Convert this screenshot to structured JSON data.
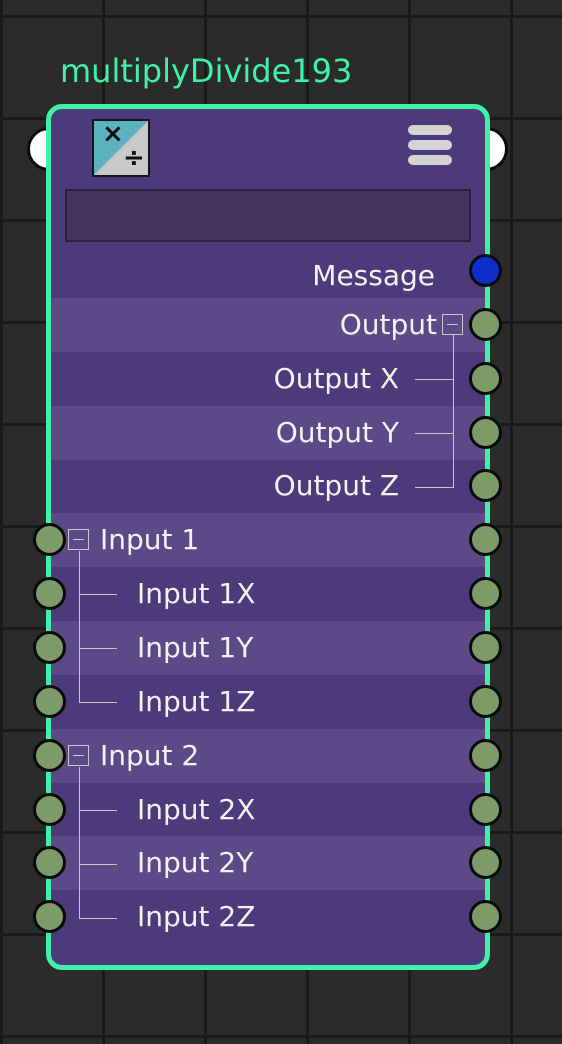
{
  "node": {
    "title": "multiplyDivide193",
    "icon": "multiply-divide-icon",
    "icon_glyphs": {
      "top": "×",
      "bottom": "÷"
    },
    "menu_icon": "node-options-menu-icon",
    "name_field_value": ""
  },
  "attributes": {
    "message": "Message",
    "output": "Output",
    "output_x": "Output X",
    "output_y": "Output Y",
    "output_z": "Output Z",
    "input1": "Input 1",
    "input1x": "Input 1X",
    "input1y": "Input 1Y",
    "input1z": "Input 1Z",
    "input2": "Input 2",
    "input2x": "Input 2X",
    "input2y": "Input 2Y",
    "input2z": "Input 2Z"
  },
  "colors": {
    "accent_border": "#3ff2a8",
    "node_body": "#4d3a7a",
    "row_alt": "#5c4a88",
    "attr_port": "#7d9a69",
    "message_port": "#0b2fc8",
    "grid_bg": "#2b2b2b"
  }
}
